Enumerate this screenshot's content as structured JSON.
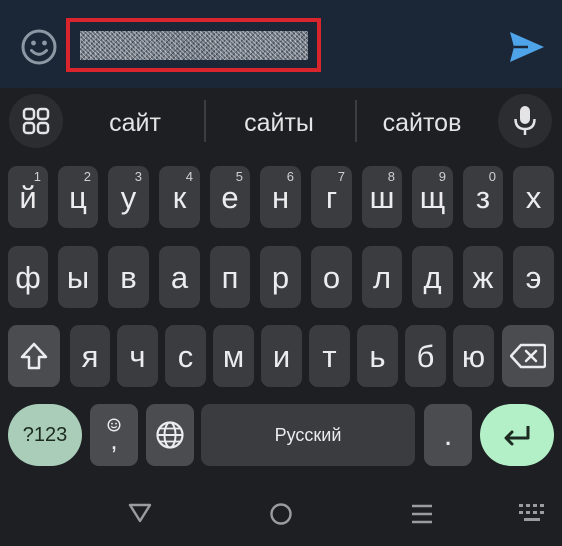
{
  "message_input": {
    "redacted": true
  },
  "suggestions": [
    "сайт",
    "сайты",
    "сайтов"
  ],
  "keyboard": {
    "row1": [
      {
        "label": "й",
        "num": "1"
      },
      {
        "label": "ц",
        "num": "2"
      },
      {
        "label": "у",
        "num": "3"
      },
      {
        "label": "к",
        "num": "4"
      },
      {
        "label": "е",
        "num": "5"
      },
      {
        "label": "н",
        "num": "6"
      },
      {
        "label": "г",
        "num": "7"
      },
      {
        "label": "ш",
        "num": "8"
      },
      {
        "label": "щ",
        "num": "9"
      },
      {
        "label": "з",
        "num": "0"
      },
      {
        "label": "х",
        "num": ""
      }
    ],
    "row2": [
      "ф",
      "ы",
      "в",
      "а",
      "п",
      "р",
      "о",
      "л",
      "д",
      "ж",
      "э"
    ],
    "row3": [
      "я",
      "ч",
      "с",
      "м",
      "и",
      "т",
      "ь",
      "б",
      "ю"
    ],
    "symbols_label": "?123",
    "comma_label": ",",
    "space_label": "Русский",
    "period_label": "."
  },
  "colors": {
    "input_bar": "#1b2736",
    "highlight_border": "#d9252c",
    "send_icon": "#4fa3e8",
    "symbols_key": "#a9cdb9",
    "enter_key": "#b3f0c8"
  },
  "icons": [
    "emoji-icon",
    "send-icon",
    "apps-grid-icon",
    "mic-icon",
    "shift-icon",
    "backspace-icon",
    "globe-icon",
    "enter-icon",
    "nav-back-icon",
    "nav-home-icon",
    "nav-recents-icon",
    "keyboard-switch-icon"
  ]
}
